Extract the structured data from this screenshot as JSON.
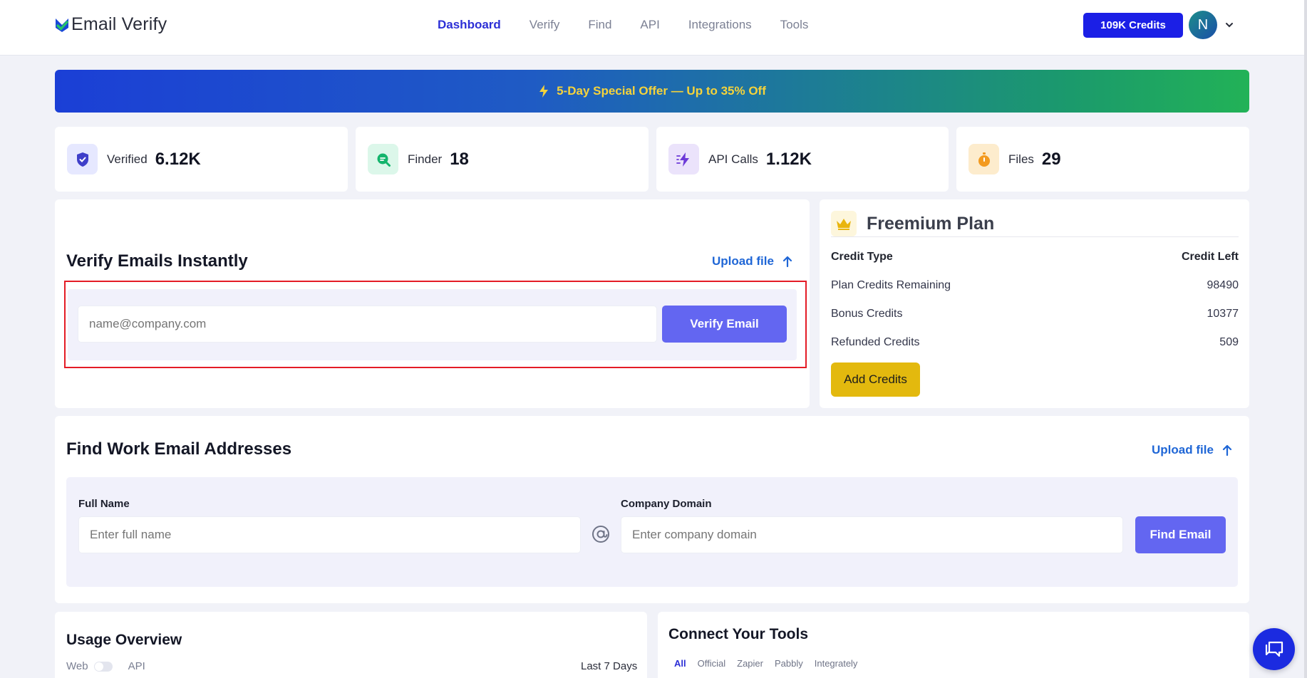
{
  "header": {
    "logo_text": "Email Verify",
    "nav": [
      "Dashboard",
      "Verify",
      "Find",
      "API",
      "Integrations",
      "Tools"
    ],
    "active_nav": "Dashboard",
    "credits_button": "109K Credits",
    "avatar_initial": "N"
  },
  "banner": {
    "text": "5-Day Special Offer — Up to 35% Off"
  },
  "stats": [
    {
      "label": "Verified",
      "value": "6.12K",
      "icon": "shield-check-icon",
      "color": "#4338ca"
    },
    {
      "label": "Finder",
      "value": "18",
      "icon": "search-chat-icon",
      "color": "#10b981"
    },
    {
      "label": "API Calls",
      "value": "1.12K",
      "icon": "lightning-icon",
      "color": "#7c3aed"
    },
    {
      "label": "Files",
      "value": "29",
      "icon": "stopwatch-icon",
      "color": "#f59e0b"
    }
  ],
  "verify": {
    "title": "Verify Emails Instantly",
    "upload_label": "Upload file",
    "input_placeholder": "name@company.com",
    "button_label": "Verify Email"
  },
  "plan": {
    "title": "Freemium Plan",
    "header_type": "Credit Type",
    "header_left": "Credit Left",
    "rows": [
      {
        "type": "Plan Credits Remaining",
        "left": "98490"
      },
      {
        "type": "Bonus Credits",
        "left": "10377"
      },
      {
        "type": "Refunded Credits",
        "left": "509"
      }
    ],
    "add_button": "Add Credits"
  },
  "find": {
    "title": "Find Work Email Addresses",
    "upload_label": "Upload file",
    "name_label": "Full Name",
    "name_placeholder": "Enter full name",
    "domain_label": "Company Domain",
    "domain_placeholder": "Enter company domain",
    "button_label": "Find Email"
  },
  "usage": {
    "title": "Usage Overview",
    "toggle_left": "Web",
    "toggle_right": "API",
    "period": "Last 7 Days"
  },
  "tools": {
    "title": "Connect Your Tools",
    "tabs": [
      "All",
      "Official",
      "Zapier",
      "Pabbly",
      "Integrately"
    ],
    "active_tab": "All"
  },
  "colors": {
    "accent": "#6366f1",
    "brand_blue": "#1b1fe6",
    "highlight_border": "#e41c26",
    "banner_text": "#f5d33b",
    "add_credits": "#e3b90e"
  }
}
